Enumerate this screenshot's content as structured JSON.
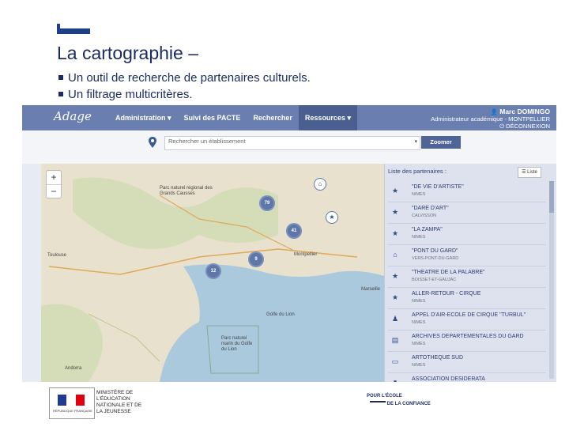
{
  "slide": {
    "title": "La cartographie –",
    "bullets": [
      "Un outil de recherche de partenaires culturels.",
      "Un filtrage multicritères."
    ]
  },
  "app": {
    "logo": "Adage",
    "nav": [
      {
        "label": "Administration ▾",
        "active": false
      },
      {
        "label": "Suivi des PACTE",
        "active": false
      },
      {
        "label": "Rechercher",
        "active": false
      },
      {
        "label": "Ressources ▾",
        "active": true
      }
    ],
    "user": {
      "name": "Marc DOMINGO",
      "role": "Administrateur académique - MONTPELLIER",
      "logout": "DÉCONNEXION"
    },
    "search": {
      "placeholder": "Rechercher un établissement",
      "button": "Zoomer"
    },
    "map": {
      "zoom_in": "+",
      "zoom_out": "−",
      "labels": [
        {
          "text": "Toulouse"
        },
        {
          "text": "Andorra"
        },
        {
          "text": "Golfe du Lion"
        },
        {
          "text": "Parc naturel régional des Grands Causses"
        },
        {
          "text": "Parc naturel marin du Golfe du Lion"
        },
        {
          "text": "Montpellier"
        },
        {
          "text": "Marseille"
        }
      ],
      "clusters": [
        "79",
        "41",
        "9",
        "12"
      ]
    },
    "partners": {
      "header": "Liste des partenaires :",
      "list_button": "Liste",
      "items": [
        {
          "name": "\"DE VIE D'ARTISTE\"",
          "city": "NIMES",
          "icon": "star-icon"
        },
        {
          "name": "\"DARE D'ART\"",
          "city": "CALVISSON",
          "icon": "star-icon"
        },
        {
          "name": "\"LA ZAMPA\"",
          "city": "NIMES",
          "icon": "star-icon"
        },
        {
          "name": "\"PONT DU GARD\"",
          "city": "VERS-PONT-DU-GARD",
          "icon": "museum-icon"
        },
        {
          "name": "\"THEATRE DE LA PALABRE\"",
          "city": "BOISSET-ET-GAUJAC",
          "icon": "star-icon"
        },
        {
          "name": "ALLER-RETOUR - CIRQUE",
          "city": "NIMES",
          "icon": "star-icon"
        },
        {
          "name": "APPEL D'AIR-ECOLE DE CIRQUE \"TURBUL\"",
          "city": "NIMES",
          "icon": "person-icon"
        },
        {
          "name": "ARCHIVES DEPARTEMENTALES DU GARD",
          "city": "NIMES",
          "icon": "archive-icon"
        },
        {
          "name": "ARTOTHEQUE SUD",
          "city": "NIMES",
          "icon": "monitor-icon"
        },
        {
          "name": "ASSOCIATION DESIDERATA",
          "city": "",
          "icon": "book-icon"
        }
      ]
    }
  },
  "footer": {
    "rf_text": "RÉPUBLIQUE FRANÇAISE",
    "ministry": "MINISTÈRE DE L'ÉDUCATION NATIONALE ET DE LA JEUNESSE",
    "ecole_line1": "POUR L'ÉCOLE",
    "ecole_line2": "DE LA CONFIANCE"
  },
  "colors": {
    "navbar": "#6a7fb0",
    "accent": "#1e3f8a",
    "cluster": "#5f77a8",
    "sea": "#aac9dd"
  }
}
